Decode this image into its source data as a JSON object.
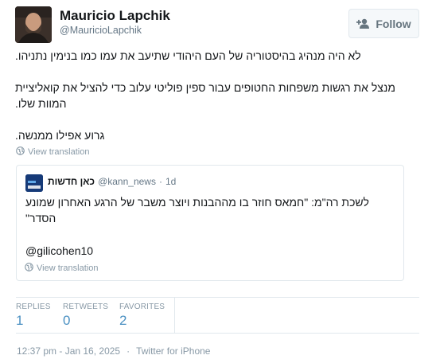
{
  "author": {
    "display_name": "Mauricio Lapchik",
    "screen_name": "@MauricioLapchik"
  },
  "follow_button": {
    "label": "Follow",
    "icon": "add-user-icon"
  },
  "tweet": {
    "lines": [
      "לא היה מנהיג בהיסטוריה של העם היהודי שתיעב את עמו כמו בנימין נתניהו.",
      "מנצל את רגשות משפחות החטופים עבור ספין פוליטי עלוב כדי להציל את קואליציית המוות שלו.",
      "גרוע אפילו ממנשה."
    ],
    "view_translation": "View translation"
  },
  "quoted_tweet": {
    "display_name": "כאן חדשות",
    "screen_name": "@kann_news",
    "separator": "·",
    "time": "1d",
    "text": "לשכת רה\"מ: \"חמאס חוזר בו מההבנות ויוצר משבר של הרגע האחרון שמונע הסדר\"",
    "mention": "@gilicohen10",
    "view_translation": "View translation"
  },
  "stats": {
    "replies_label": "REPLIES",
    "replies_value": "1",
    "retweets_label": "RETWEETS",
    "retweets_value": "0",
    "favorites_label": "FAVORITES",
    "favorites_value": "2"
  },
  "footer": {
    "timestamp": "12:37 pm - Jan 16, 2025",
    "separator": "·",
    "source": "Twitter for iPhone"
  },
  "colors": {
    "link_blue": "#4a90c2",
    "muted_gray": "#8899a6",
    "border": "#e1e8ed",
    "button_bg": "#f5f8fa"
  }
}
